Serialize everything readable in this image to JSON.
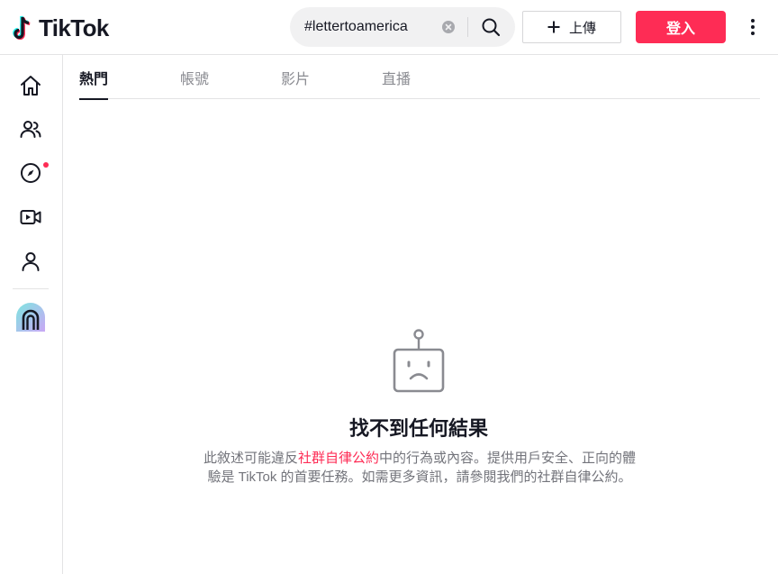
{
  "header": {
    "logo_text": "TikTok",
    "search": {
      "value": "#lettertoamerica",
      "placeholder": "搜尋"
    },
    "upload_label": "上傳",
    "login_label": "登入"
  },
  "sidebar": {
    "items": [
      {
        "name": "home",
        "icon": "home-icon"
      },
      {
        "name": "following",
        "icon": "users-icon"
      },
      {
        "name": "explore",
        "icon": "compass-icon",
        "has_notification_dot": true
      },
      {
        "name": "live",
        "icon": "live-video-icon"
      },
      {
        "name": "profile",
        "icon": "user-icon"
      }
    ],
    "avatar_icon": "app-avatar-icon"
  },
  "tabs": [
    {
      "label": "熱門",
      "active": true
    },
    {
      "label": "帳號",
      "active": false
    },
    {
      "label": "影片",
      "active": false
    },
    {
      "label": "直播",
      "active": false
    }
  ],
  "empty_state": {
    "icon": "sad-robot-icon",
    "title": "找不到任何結果",
    "desc_before": "此敘述可能違反",
    "desc_link": "社群自律公約",
    "desc_after": "中的行為或內容。提供用戶安全、正向的體驗是 TikTok 的首要任務。如需更多資訊，請參閱我們的社群自律公約。"
  },
  "colors": {
    "brand": "#fe2c55",
    "text_primary": "#161823",
    "text_secondary": "#73747b",
    "divider": "#e3e3e4"
  }
}
